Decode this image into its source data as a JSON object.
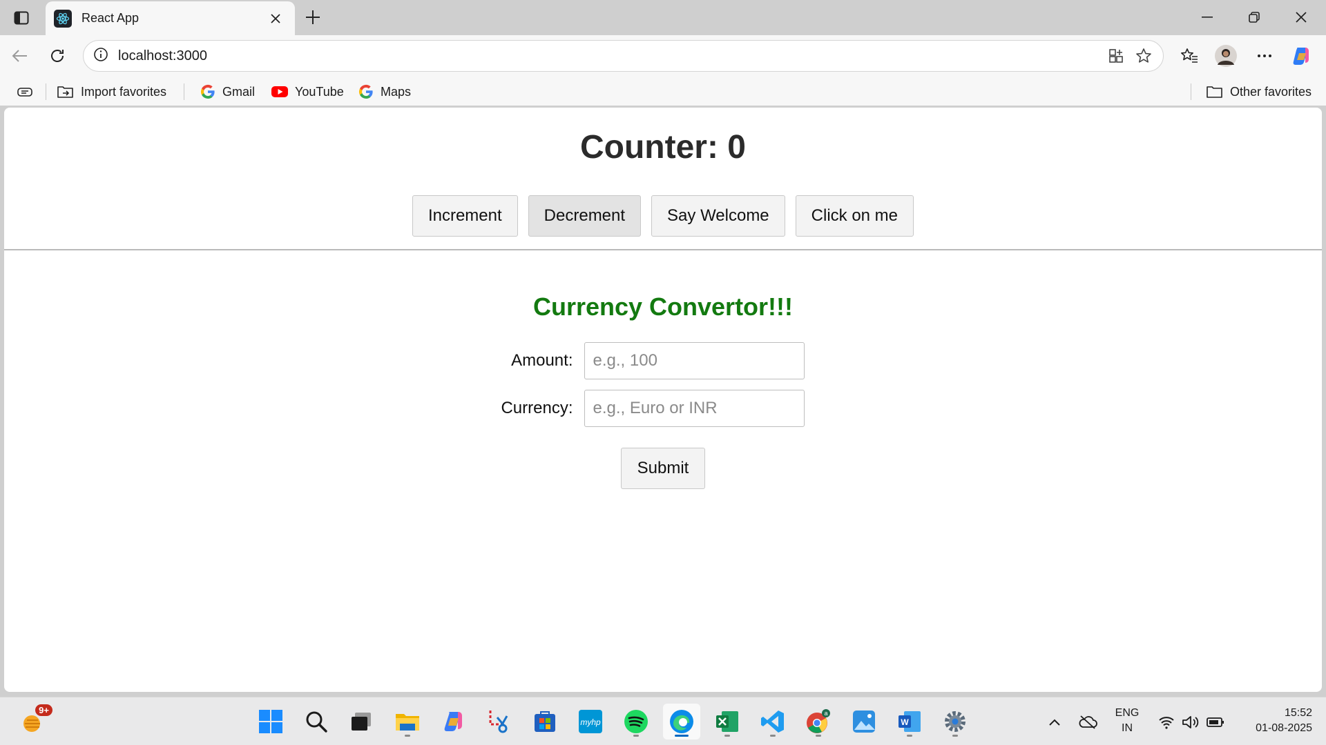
{
  "browser": {
    "tab_title": "React App",
    "url": "localhost:3000",
    "favorites": [
      {
        "label": "Import favorites",
        "icon": "import-favorites-icon"
      },
      {
        "label": "Gmail",
        "icon": "google-icon"
      },
      {
        "label": "YouTube",
        "icon": "youtube-icon"
      },
      {
        "label": "Maps",
        "icon": "google-icon"
      }
    ],
    "other_favorites": "Other favorites"
  },
  "app": {
    "counter_label": "Counter: 0",
    "buttons": [
      "Increment",
      "Decrement",
      "Say Welcome",
      "Click on me"
    ],
    "currency_title": "Currency Convertor!!!",
    "amount_label": "Amount:",
    "amount_placeholder": "e.g., 100",
    "currency_label": "Currency:",
    "currency_placeholder": "e.g., Euro or INR",
    "submit_label": "Submit",
    "title_color": "#137a10"
  },
  "taskbar": {
    "weather_badge": "9+",
    "apps": [
      "start",
      "search",
      "task-view",
      "file-explorer",
      "copilot",
      "snipping-tool",
      "microsoft-store",
      "myhp",
      "spotify",
      "edge",
      "excel",
      "vscode",
      "chrome",
      "photos",
      "word",
      "settings"
    ],
    "lang_top": "ENG",
    "lang_bottom": "IN",
    "time": "15:52",
    "date": "01-08-2025"
  }
}
